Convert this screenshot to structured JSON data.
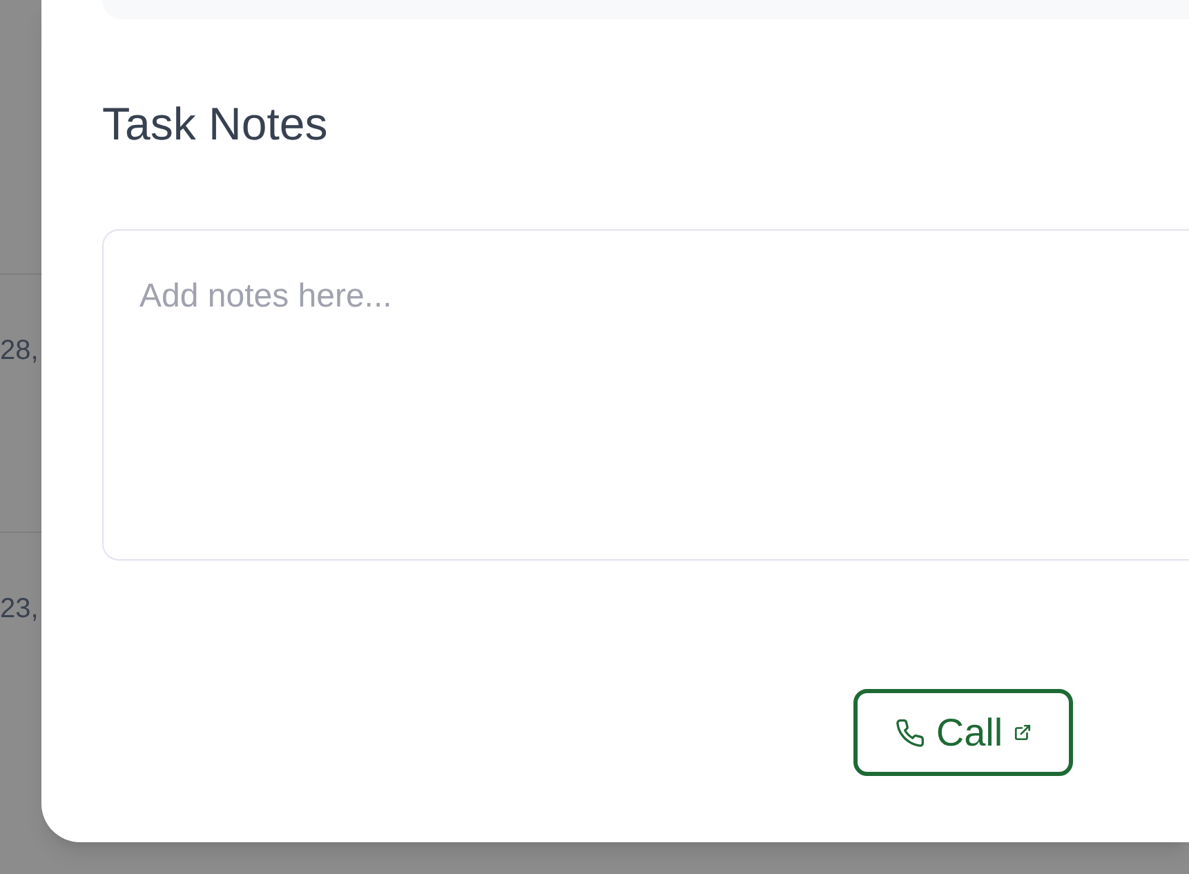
{
  "background_rows": [
    {
      "column_1": "28,"
    },
    {
      "column_1": "23,"
    }
  ],
  "task_notes": {
    "title": "Task Notes",
    "placeholder": "Add notes here..."
  },
  "call_button": {
    "label": "Call"
  }
}
